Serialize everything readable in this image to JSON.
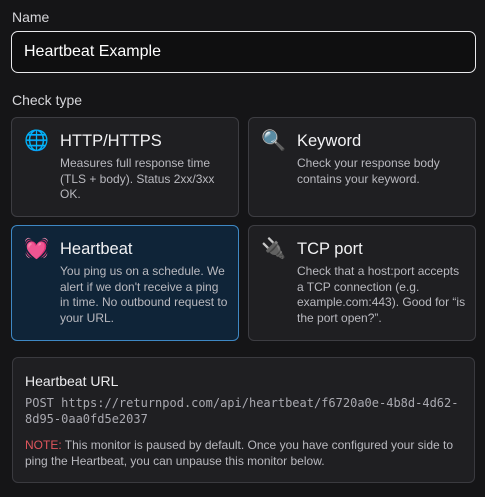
{
  "form": {
    "name_label": "Name",
    "name_value": "Heartbeat Example",
    "check_type_label": "Check type"
  },
  "check_types": [
    {
      "title": "HTTP/HTTPS",
      "icon": "globe-icon",
      "icon_glyph": "🌐",
      "description": "Measures full response time (TLS + body). Status 2xx/3xx OK.",
      "selected": false
    },
    {
      "title": "Keyword",
      "icon": "magnifier-icon",
      "icon_glyph": "🔍",
      "description": "Check your response body contains your keyword.",
      "selected": false
    },
    {
      "title": "Heartbeat",
      "icon": "heart-icon",
      "icon_glyph": "💓",
      "description": "You ping us on a schedule. We alert if we don't receive a ping in time. No outbound request to your URL.",
      "selected": true
    },
    {
      "title": "TCP port",
      "icon": "plug-icon",
      "icon_glyph": "🔌",
      "description": "Check that a host:port accepts a TCP connection (e.g. example.com:443). Good for “is the port open?”.",
      "selected": false
    }
  ],
  "heartbeat_url": {
    "title": "Heartbeat URL",
    "value": "POST https://returnpod.com/api/heartbeat/f6720a0e-4b8d-4d62-8d95-0aa0fd5e2037",
    "note_label": "NOTE:",
    "note_text": " This monitor is paused by default. Once you have configured your side to ping the Heartbeat, you can unpause this monitor below."
  },
  "colors": {
    "background": "#151517",
    "card_background": "#1f1f22",
    "selected_card_background": "#0f2438",
    "selected_border": "#3e88c4",
    "note_accent": "#e0565d"
  }
}
